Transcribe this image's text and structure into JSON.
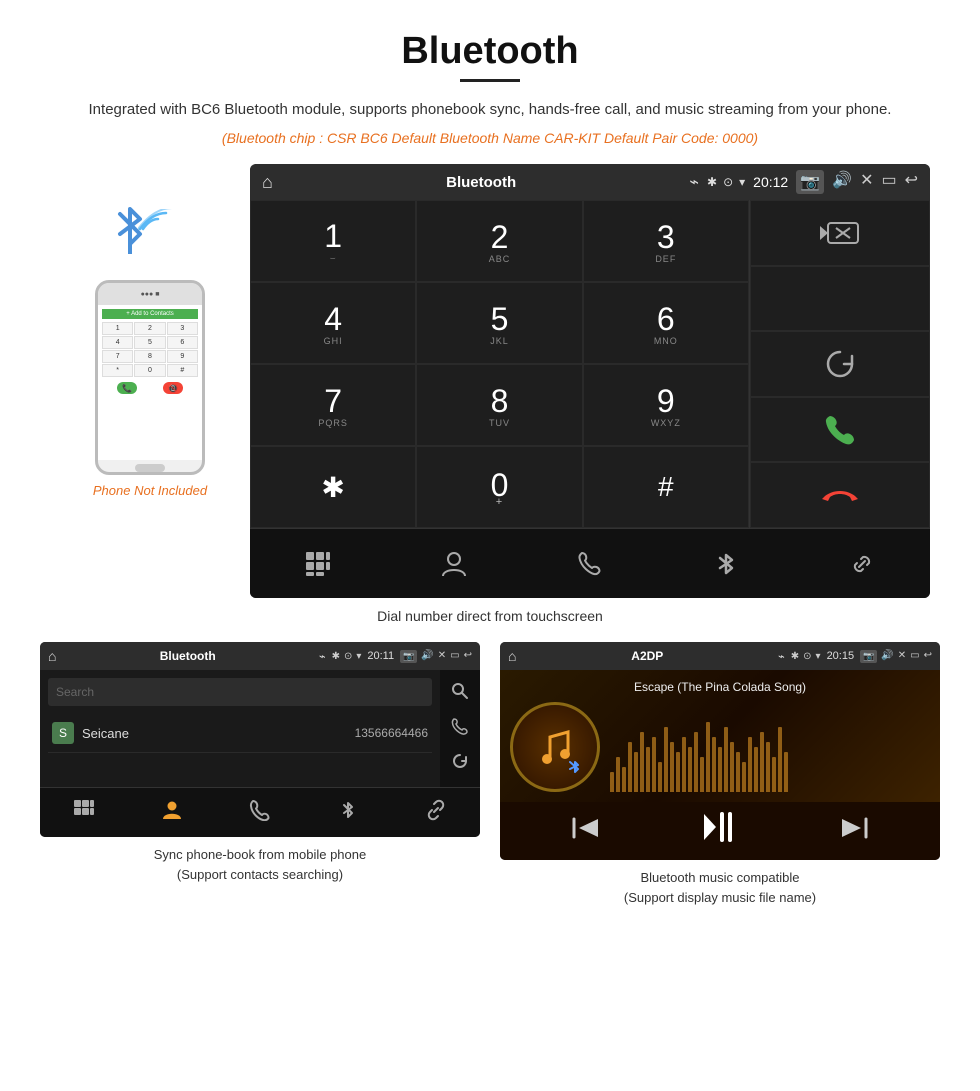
{
  "header": {
    "title": "Bluetooth",
    "underline": true,
    "description": "Integrated with BC6 Bluetooth module, supports phonebook sync, hands-free call, and music streaming from your phone.",
    "orange_info": "(Bluetooth chip : CSR BC6    Default Bluetooth Name CAR-KIT    Default Pair Code: 0000)"
  },
  "main_screen": {
    "status_bar": {
      "title": "Bluetooth",
      "usb_icon": "⌁",
      "time": "20:12",
      "icons": [
        "📷",
        "🔊",
        "✕",
        "▭",
        "↩"
      ]
    },
    "dialer": {
      "keys": [
        {
          "num": "1",
          "sub": ""
        },
        {
          "num": "2",
          "sub": "ABC"
        },
        {
          "num": "3",
          "sub": "DEF"
        },
        {
          "num": "4",
          "sub": "GHI"
        },
        {
          "num": "5",
          "sub": "JKL"
        },
        {
          "num": "6",
          "sub": "MNO"
        },
        {
          "num": "7",
          "sub": "PQRS"
        },
        {
          "num": "8",
          "sub": "TUV"
        },
        {
          "num": "9",
          "sub": "WXYZ"
        },
        {
          "num": "*",
          "sub": ""
        },
        {
          "num": "0",
          "sub": "+"
        },
        {
          "num": "#",
          "sub": ""
        }
      ]
    },
    "caption": "Dial number direct from touchscreen"
  },
  "phone_side": {
    "not_included": "Phone Not Included",
    "contact_label": "+ Add to Contacts",
    "keys": [
      "1",
      "2",
      "3",
      "4",
      "5",
      "6",
      "7",
      "8",
      "9",
      "*",
      "0",
      "#"
    ]
  },
  "phonebook_screen": {
    "status_bar": {
      "title": "Bluetooth",
      "time": "20:11"
    },
    "search_placeholder": "Search",
    "contact": {
      "letter": "S",
      "name": "Seicane",
      "phone": "13566664466"
    },
    "caption": "Sync phone-book from mobile phone\n(Support contacts searching)"
  },
  "music_screen": {
    "status_bar": {
      "title": "A2DP",
      "time": "20:15"
    },
    "song_title": "Escape (The Pina Colada Song)",
    "wave_heights": [
      20,
      35,
      25,
      50,
      40,
      60,
      45,
      55,
      30,
      65,
      50,
      40,
      55,
      45,
      60,
      35,
      70,
      55,
      45,
      65,
      50,
      40,
      30,
      55,
      45,
      60,
      50,
      35,
      65,
      40
    ],
    "caption": "Bluetooth music compatible\n(Support display music file name)"
  },
  "nav_icons": {
    "grid": "⠿",
    "person": "👤",
    "phone": "📞",
    "bluetooth": "✱",
    "link": "🔗"
  }
}
